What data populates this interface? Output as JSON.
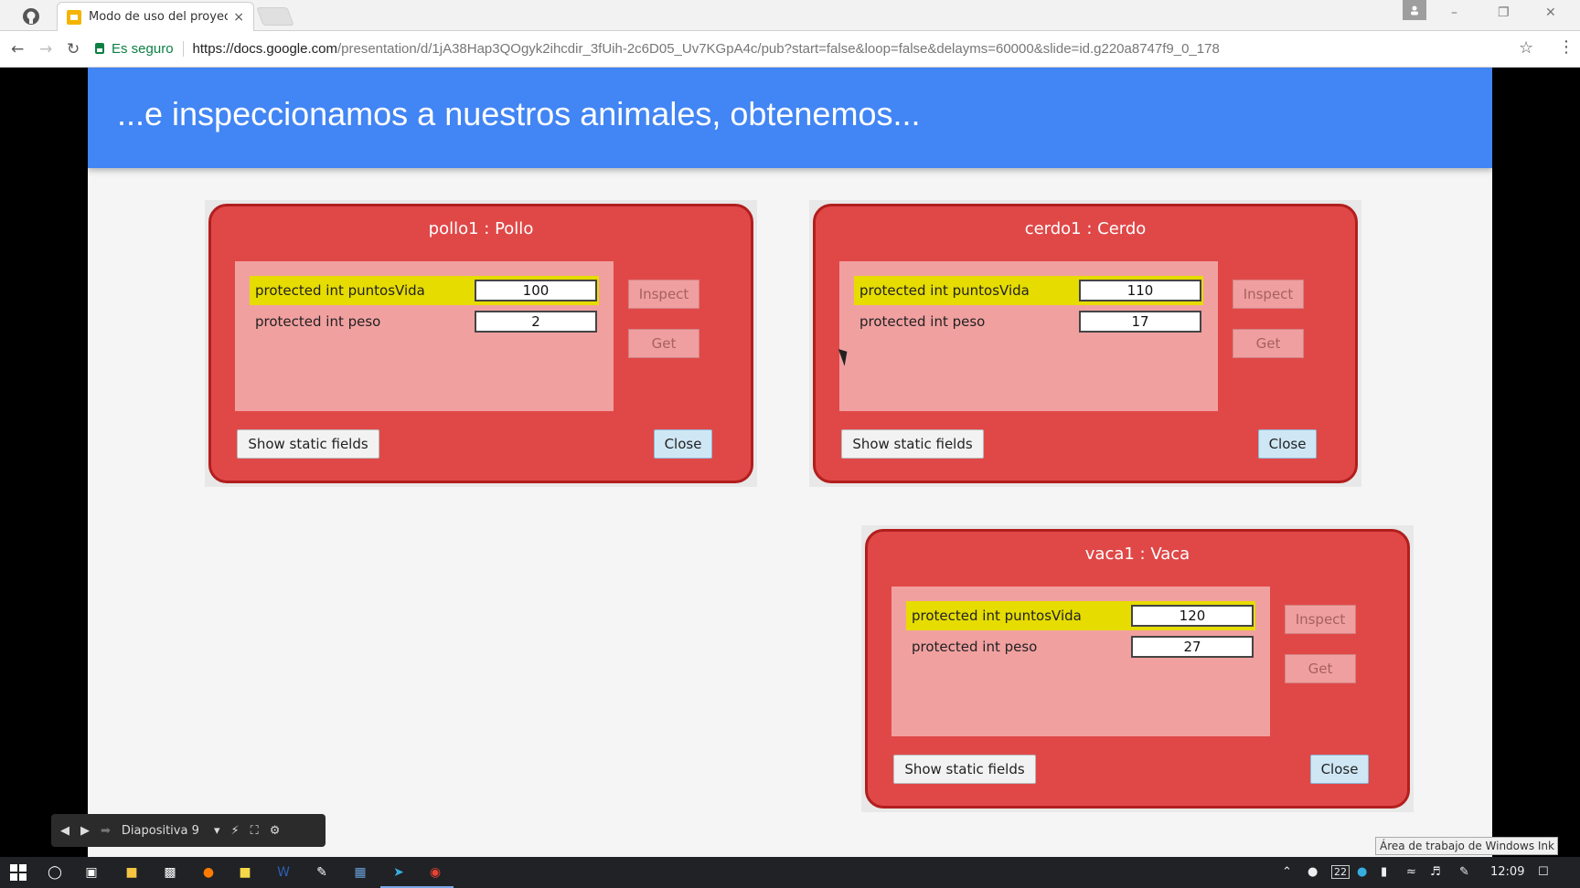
{
  "browser": {
    "tab_title": "Modo de uso del proyec",
    "tab_close": "×",
    "secure_label": "Es seguro",
    "url_host": "https://docs.google.com",
    "url_path": "/presentation/d/1jA38Hap3QOgyk2ihcdir_3fUih-2c6D05_Uv7KGpA4c/pub?start=false&loop=false&delayms=60000&slide=id.g220a8747f9_0_178"
  },
  "slide": {
    "title": "...e inspeccionamos a nuestros animales, obtenemos...",
    "panels": [
      {
        "title": "pollo1 : Pollo",
        "fields": [
          {
            "label": "protected int puntosVida",
            "value": "100"
          },
          {
            "label": "protected int peso",
            "value": "2"
          }
        ]
      },
      {
        "title": "cerdo1 : Cerdo",
        "fields": [
          {
            "label": "protected int puntosVida",
            "value": "110"
          },
          {
            "label": "protected int peso",
            "value": "17"
          }
        ]
      },
      {
        "title": "vaca1 : Vaca",
        "fields": [
          {
            "label": "protected int puntosVida",
            "value": "120"
          },
          {
            "label": "protected int peso",
            "value": "27"
          }
        ]
      }
    ],
    "buttons": {
      "inspect": "Inspect",
      "get": "Get",
      "show_static": "Show static fields",
      "close": "Close"
    }
  },
  "presentation": {
    "slide_label": "Diapositiva 9"
  },
  "ink_tooltip": "Área de trabajo de Windows Ink",
  "taskbar": {
    "clock": "12:09",
    "badge": "22"
  }
}
